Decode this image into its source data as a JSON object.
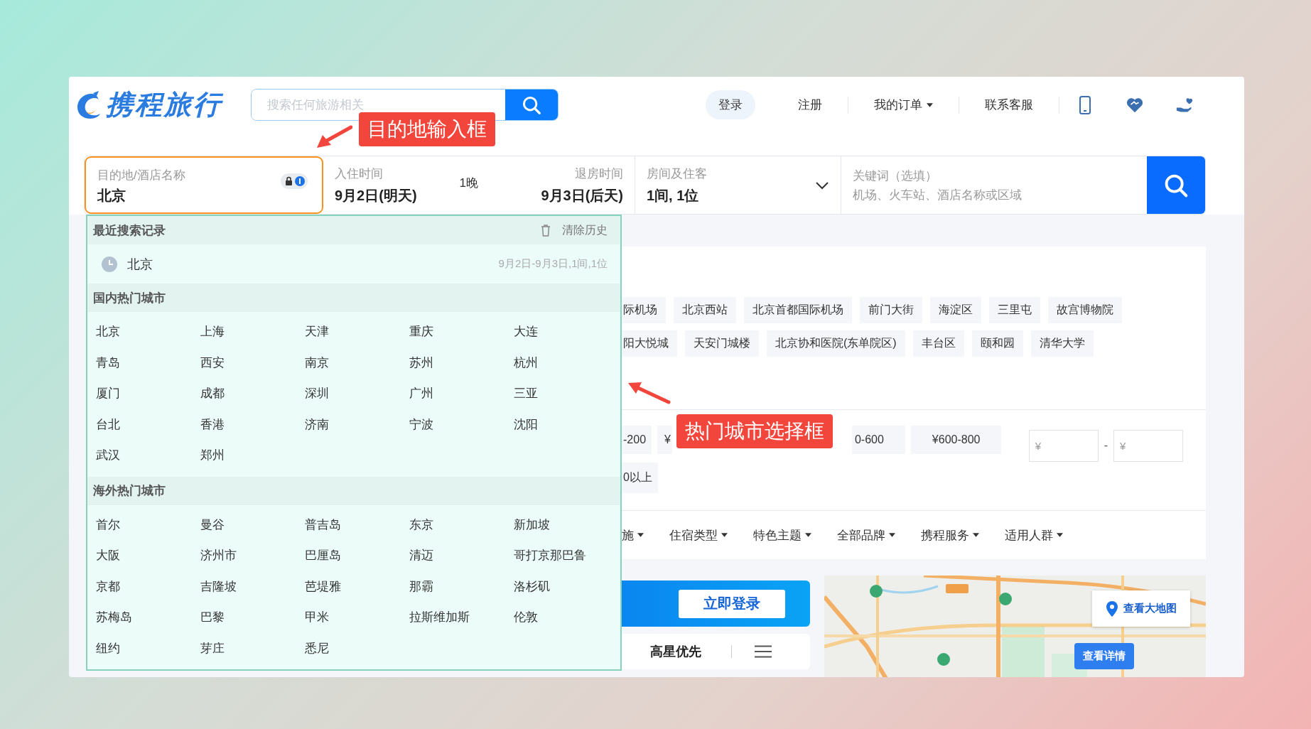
{
  "logo": {
    "text": "携程旅行"
  },
  "header_search": {
    "placeholder": "搜索任何旅游相关"
  },
  "nav": [
    {
      "label": "登录",
      "kind": "pill"
    },
    {
      "label": "注册",
      "kind": "link"
    },
    {
      "label": "我的订单",
      "kind": "dropdown"
    },
    {
      "label": "联系客服",
      "kind": "link"
    }
  ],
  "hotel_search": {
    "destination": {
      "label": "目的地/酒店名称",
      "value": "北京"
    },
    "checkin": {
      "label": "入住时间",
      "value": "9月2日(明天)"
    },
    "nights": "1晚",
    "checkout": {
      "label": "退房时间",
      "value": "9月3日(后天)"
    },
    "rooms": {
      "label": "房间及住客",
      "value": "1间, 1位"
    },
    "keyword": {
      "label": "关键词（选填）",
      "placeholder": "机场、火车站、酒店名称或区域"
    }
  },
  "city_dropdown": {
    "recent_title": "最近搜索记录",
    "clear": "清除历史",
    "history": [
      {
        "city": "北京",
        "detail": "9月2日-9月3日,1间,1位"
      }
    ],
    "sections": [
      {
        "title": "国内热门城市",
        "cities": [
          "北京",
          "上海",
          "天津",
          "重庆",
          "大连",
          "青岛",
          "西安",
          "南京",
          "苏州",
          "杭州",
          "厦门",
          "成都",
          "深圳",
          "广州",
          "三亚",
          "台北",
          "香港",
          "济南",
          "宁波",
          "沈阳",
          "武汉",
          "郑州"
        ]
      },
      {
        "title": "海外热门城市",
        "cities": [
          "首尔",
          "曼谷",
          "普吉岛",
          "东京",
          "新加坡",
          "大阪",
          "济州市",
          "巴厘岛",
          "清迈",
          "哥打京那巴鲁",
          "京都",
          "吉隆坡",
          "芭堤雅",
          "那霸",
          "洛杉矶",
          "苏梅岛",
          "巴黎",
          "甲米",
          "拉斯维加斯",
          "伦敦",
          "纽约",
          "芽庄",
          "悉尼"
        ]
      }
    ]
  },
  "location_tags": [
    [
      "际机场",
      "北京西站",
      "北京首都国际机场",
      "前门大街",
      "海淀区",
      "三里屯",
      "故宫博物院"
    ],
    [
      "阳大悦城",
      "天安门城楼",
      "北京协和医院(东单院区)",
      "丰台区",
      "颐和园",
      "清华大学"
    ]
  ],
  "price": {
    "chips": [
      [
        "-200",
        "¥",
        "0-600",
        "¥600-800"
      ],
      [
        "0以上"
      ]
    ],
    "min_placeholder": "¥",
    "separator": "-",
    "max_placeholder": "¥"
  },
  "filters": [
    "施",
    "住宿类型",
    "特色主题",
    "全部品牌",
    "携程服务",
    "适用人群"
  ],
  "login_banner": {
    "button": "立即登录"
  },
  "sort": {
    "label": "高星优先"
  },
  "map": {
    "kind": "picture",
    "big_map": "查看大地图",
    "details": "查看详情"
  },
  "annotations": [
    {
      "text": "目的地输入框"
    },
    {
      "text": "热门城市选择框"
    }
  ]
}
